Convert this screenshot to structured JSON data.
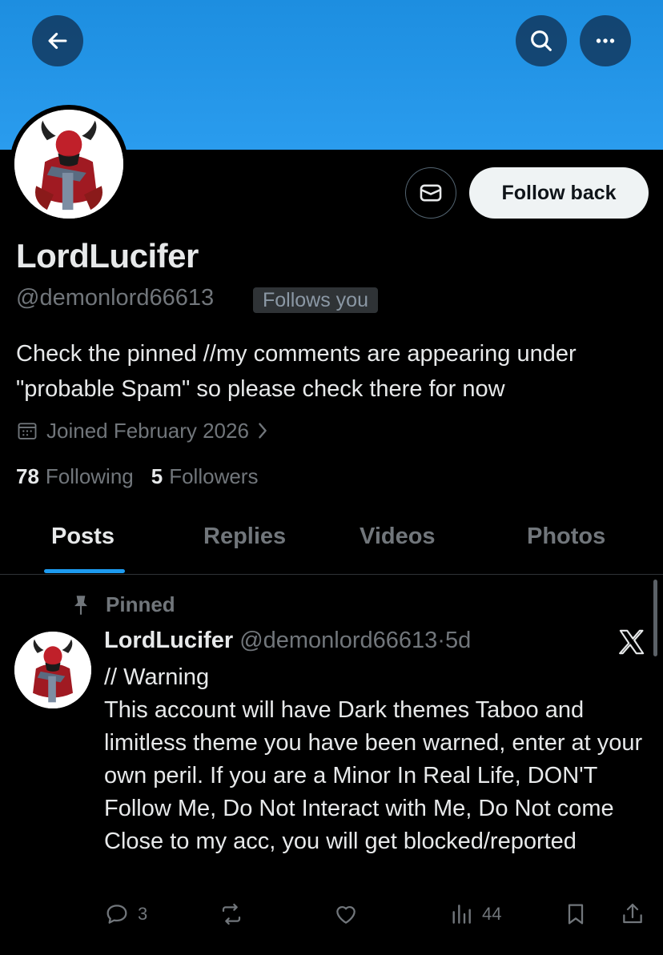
{
  "header": {
    "back_icon": "arrow-left-icon",
    "search_icon": "search-icon",
    "more_icon": "more-horizontal-icon",
    "banner_color": "#1d8ee0"
  },
  "profile": {
    "display_name": "LordLucifer",
    "handle": "@demonlord66613",
    "follows_you_badge": "Follows you",
    "follow_button_label": "Follow back",
    "message_icon": "envelope-icon",
    "bio": "Check the pinned //my comments are appearing under \"probable Spam\" so please check there for now",
    "joined": "Joined February 2026",
    "following_count": "78",
    "following_label": "Following",
    "followers_count": "5",
    "followers_label": "Followers"
  },
  "tabs": [
    {
      "label": "Posts",
      "active": true
    },
    {
      "label": "Replies",
      "active": false
    },
    {
      "label": "Videos",
      "active": false
    },
    {
      "label": "Photos",
      "active": false
    }
  ],
  "pinned_post": {
    "pinned_label": "Pinned",
    "author_name": "LordLucifer",
    "author_handle": "@demonlord66613",
    "separator": "·",
    "time": "5d",
    "text": "// Warning\nThis account will have Dark themes Taboo and limitless theme you have been warned, enter at your own peril. If you are a Minor In Real Life, DON'T Follow Me, Do Not Interact with Me, Do Not come Close to my acc, you will get blocked/reported",
    "replies_count": "3",
    "views_count": "44",
    "accent_color": "#1d9bf0"
  }
}
